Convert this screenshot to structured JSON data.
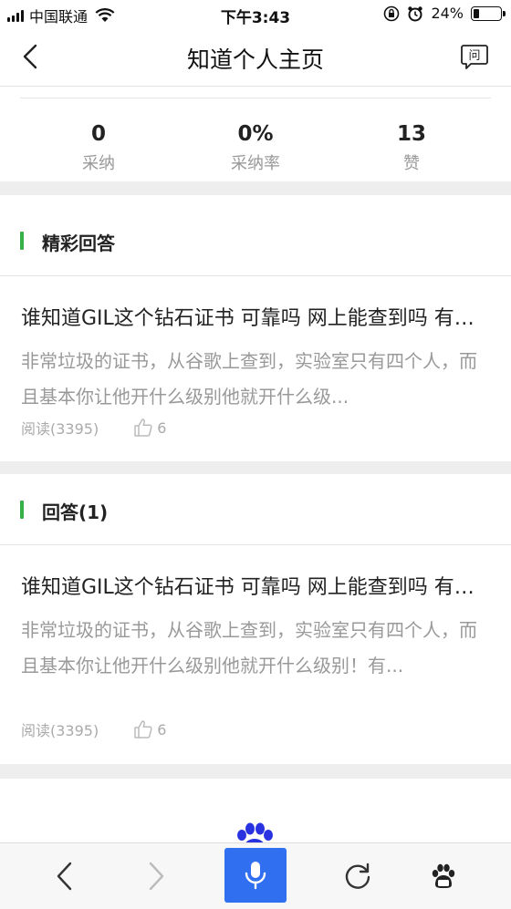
{
  "status_bar": {
    "carrier": "中国联通",
    "time": "下午3:43",
    "battery_percent": "24%",
    "battery_level": 0.24
  },
  "nav": {
    "title": "知道个人主页",
    "back_icon": "chevron-left-icon",
    "ask_icon": "ask-question-icon",
    "ask_glyph": "问"
  },
  "stats": [
    {
      "value": "0",
      "label": "采纳"
    },
    {
      "value": "0%",
      "label": "采纳率"
    },
    {
      "value": "13",
      "label": "赞"
    }
  ],
  "sections": {
    "featured": {
      "title": "精彩回答",
      "item": {
        "title": "谁知道GIL这个钻石证书 可靠吗 网上能查到吗 有用吗",
        "body": "非常垃圾的证书，从谷歌上查到，实验室只有四个人，而且基本你让他开什么级别他就开什么级...",
        "reads": "阅读(3395)",
        "likes": "6"
      }
    },
    "answers": {
      "title": "回答(1)",
      "item": {
        "title": "谁知道GIL这个钻石证书 可靠吗 网上能查到吗 有用吗",
        "body": "非常垃圾的证书，从谷歌上查到，实验室只有四个人，而且基本你让他开什么级别他就开什么级别！有...",
        "reads": "阅读(3395)",
        "likes": "6"
      }
    }
  },
  "toolbar": {
    "icons": [
      "back-icon",
      "forward-icon",
      "voice-mic-icon",
      "refresh-icon",
      "baidu-paw-icon"
    ]
  },
  "colors": {
    "accent_green": "#38b048",
    "voice_blue": "#2f6ff0",
    "paw_blue": "#2932e1",
    "gray_text": "#999999"
  }
}
